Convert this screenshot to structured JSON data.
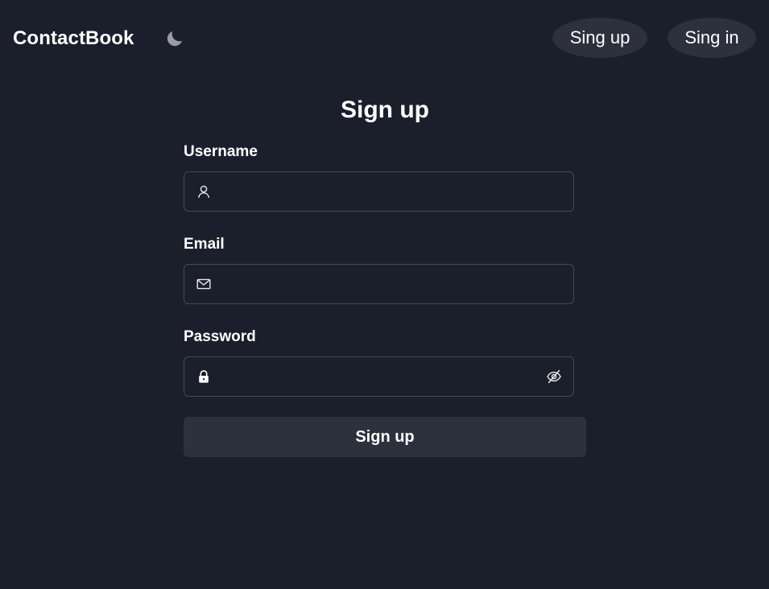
{
  "header": {
    "brand": "ContactBook",
    "theme_icon": "moon-icon",
    "nav": [
      {
        "label": "Sing up"
      },
      {
        "label": "Sing in"
      }
    ]
  },
  "form": {
    "title": "Sign up",
    "fields": {
      "username": {
        "label": "Username",
        "icon": "user-icon",
        "value": "",
        "placeholder": ""
      },
      "email": {
        "label": "Email",
        "icon": "mail-icon",
        "value": "",
        "placeholder": ""
      },
      "password": {
        "label": "Password",
        "icon": "lock-icon",
        "toggle_icon": "eye-off-icon",
        "value": "",
        "placeholder": ""
      }
    },
    "submit_label": "Sign up"
  },
  "colors": {
    "background": "#1b1f2b",
    "button": "#2d303d",
    "field_border": "#444858",
    "text": "#ffffff",
    "icon_muted": "#9a9ca6"
  }
}
